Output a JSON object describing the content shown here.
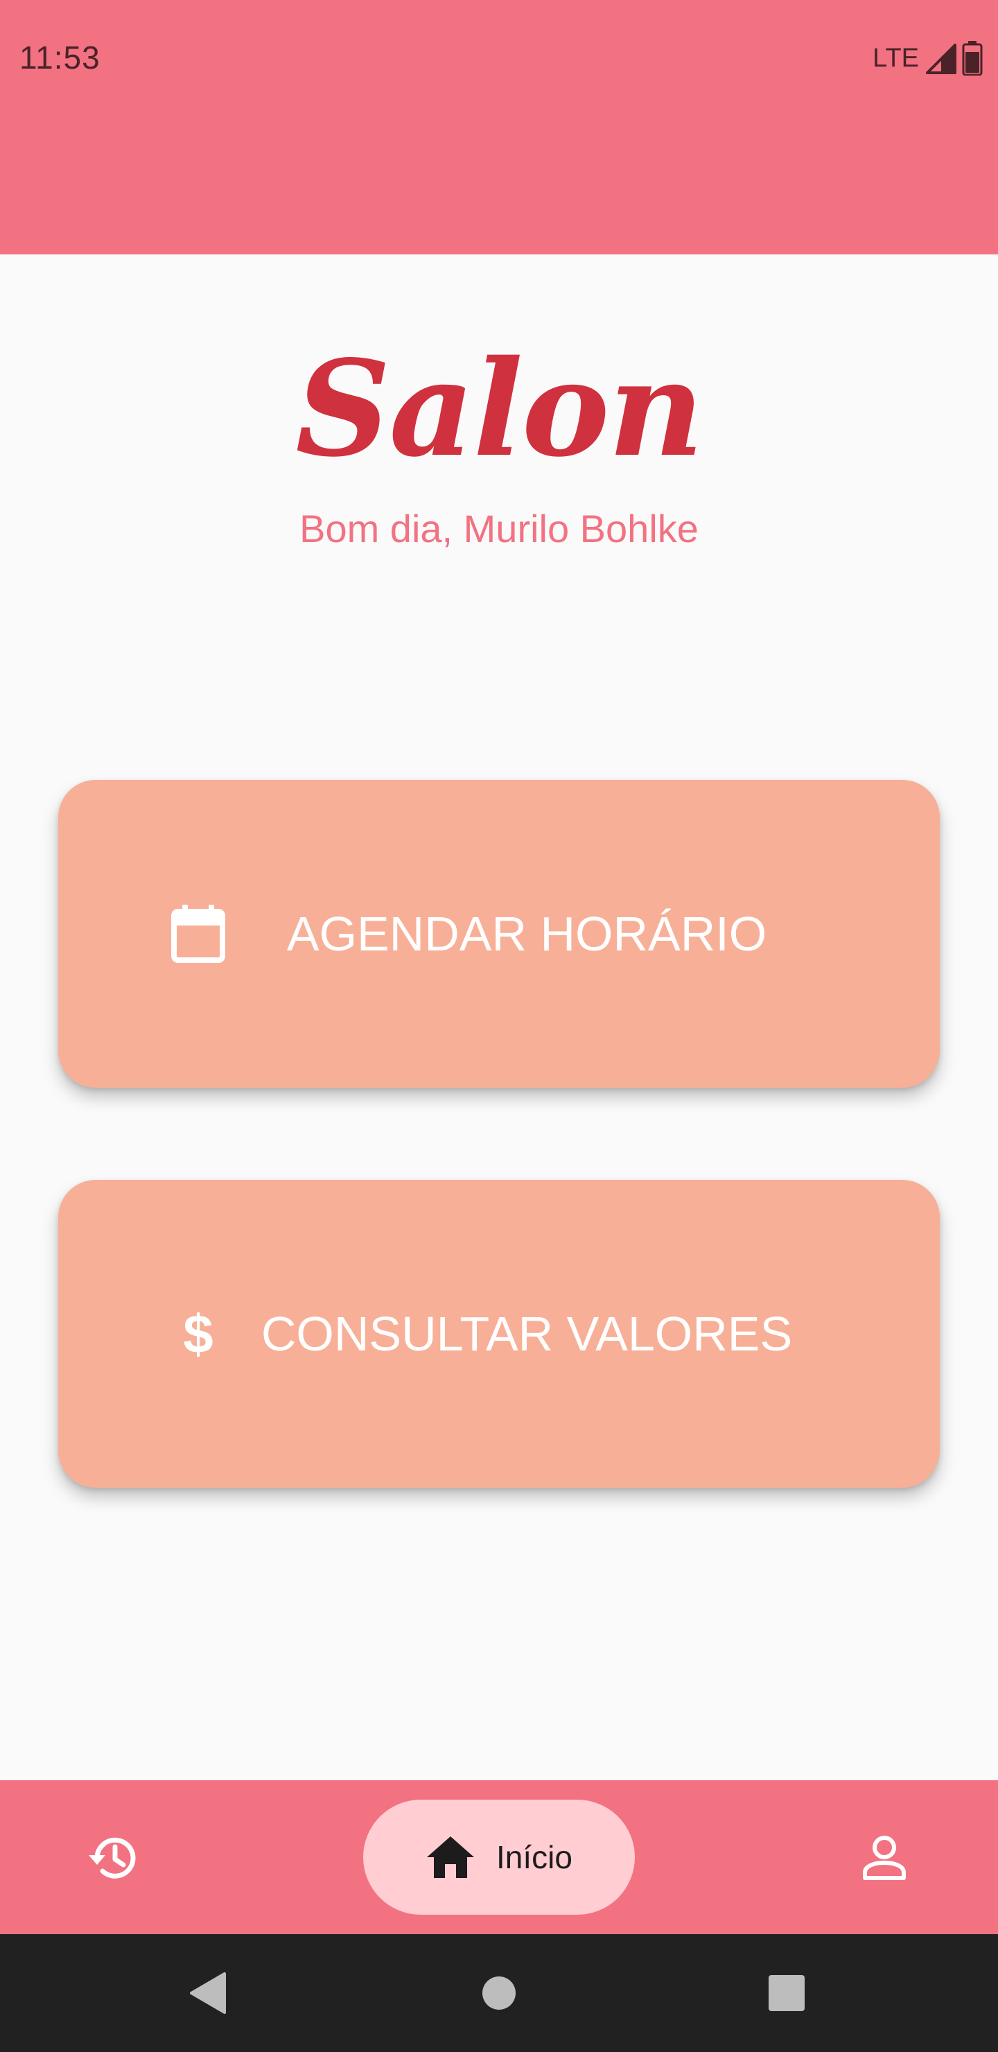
{
  "status_bar": {
    "time": "11:53",
    "network": "LTE"
  },
  "header": {
    "brand": "Salon",
    "greeting": "Bom dia, Murilo Bohlke"
  },
  "actions": [
    {
      "label": "AGENDAR HORÁRIO",
      "icon": "calendar-icon"
    },
    {
      "label": "CONSULTAR VALORES",
      "icon": "dollar-icon"
    }
  ],
  "bottom_nav": {
    "items": [
      {
        "label": "",
        "icon": "history-icon"
      },
      {
        "label": "Início",
        "icon": "home-icon",
        "selected": true
      },
      {
        "label": "",
        "icon": "person-icon"
      }
    ]
  },
  "system_nav": {
    "buttons": [
      "back-icon",
      "home-circle-icon",
      "recents-icon"
    ]
  },
  "colors": {
    "primary": "#F27282",
    "brand_text": "#D0313E",
    "card": "#F7B097",
    "nav_pill": "#FFCDD2",
    "background": "#FAFAFA",
    "system_nav": "#212121"
  }
}
